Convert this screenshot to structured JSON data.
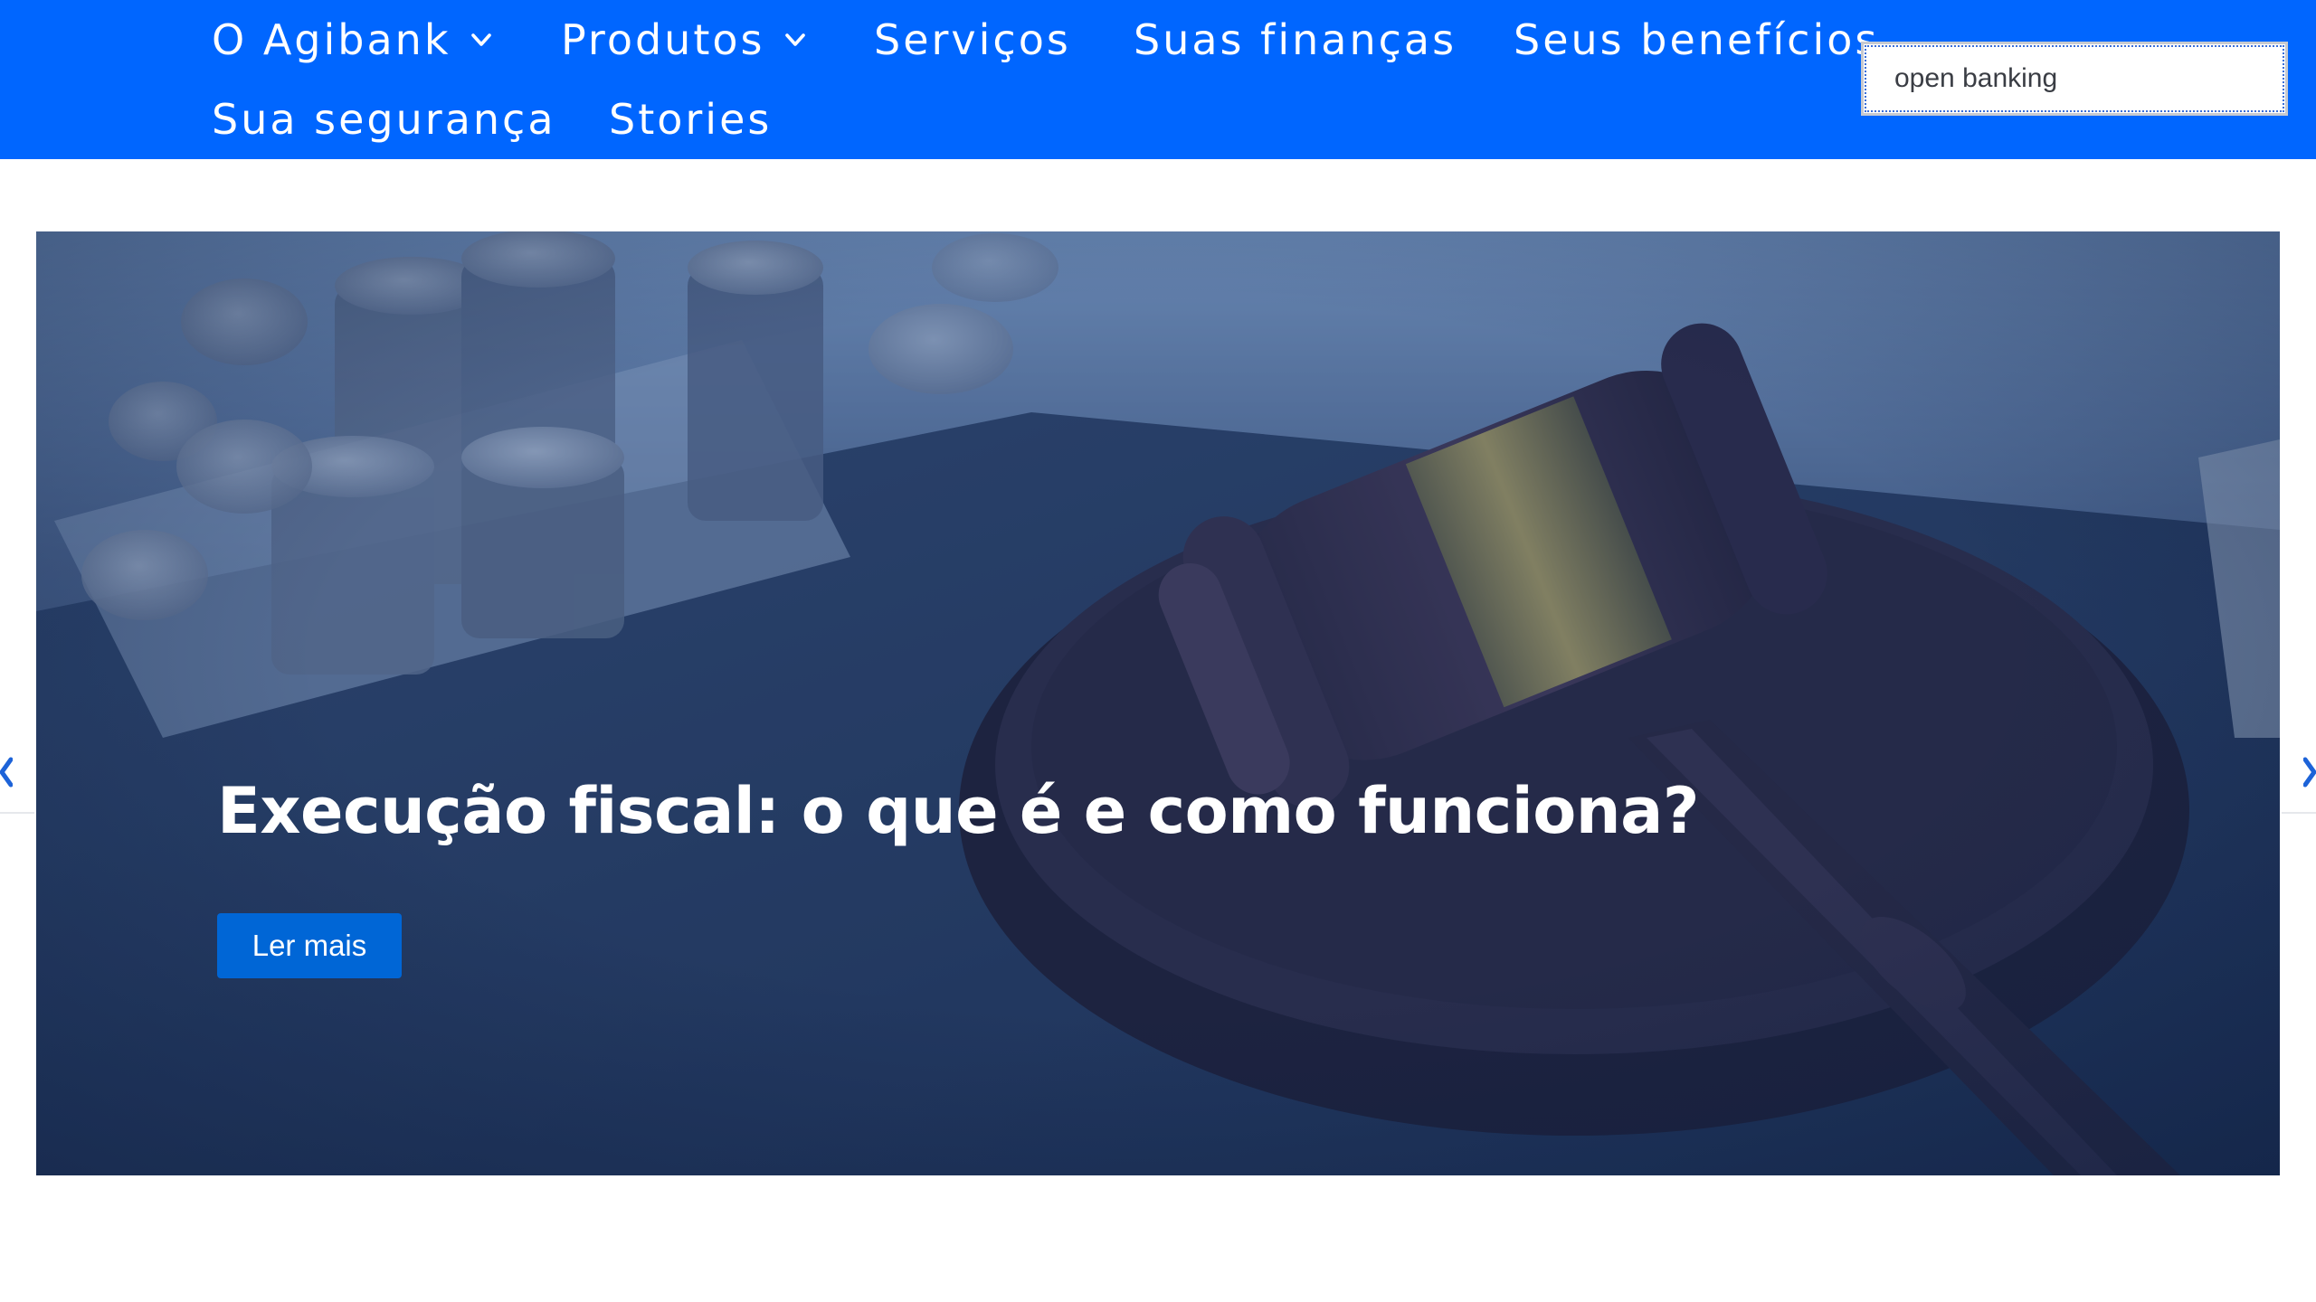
{
  "nav": {
    "items": [
      {
        "label": "O Agibank",
        "has_dropdown": true
      },
      {
        "label": "Produtos",
        "has_dropdown": true
      },
      {
        "label": "Serviços",
        "has_dropdown": false
      },
      {
        "label": "Suas finanças",
        "has_dropdown": false
      },
      {
        "label": "Seus benefícios",
        "has_dropdown": false
      },
      {
        "label": "Sua segurança",
        "has_dropdown": false
      },
      {
        "label": "Stories",
        "has_dropdown": false
      }
    ],
    "dropdown_icon": "chevron-down-icon"
  },
  "search": {
    "value": "open banking"
  },
  "hero": {
    "title": "Execução fiscal: o que é e como funciona?",
    "button_label": "Ler mais",
    "image": "gavel-and-coins"
  },
  "carousel": {
    "prev_icon": "chevron-left-icon",
    "next_icon": "chevron-right-icon"
  },
  "colors": {
    "nav_background": "#0066ff",
    "button_background": "#0066d6",
    "hero_overlay": "#1d3766"
  }
}
